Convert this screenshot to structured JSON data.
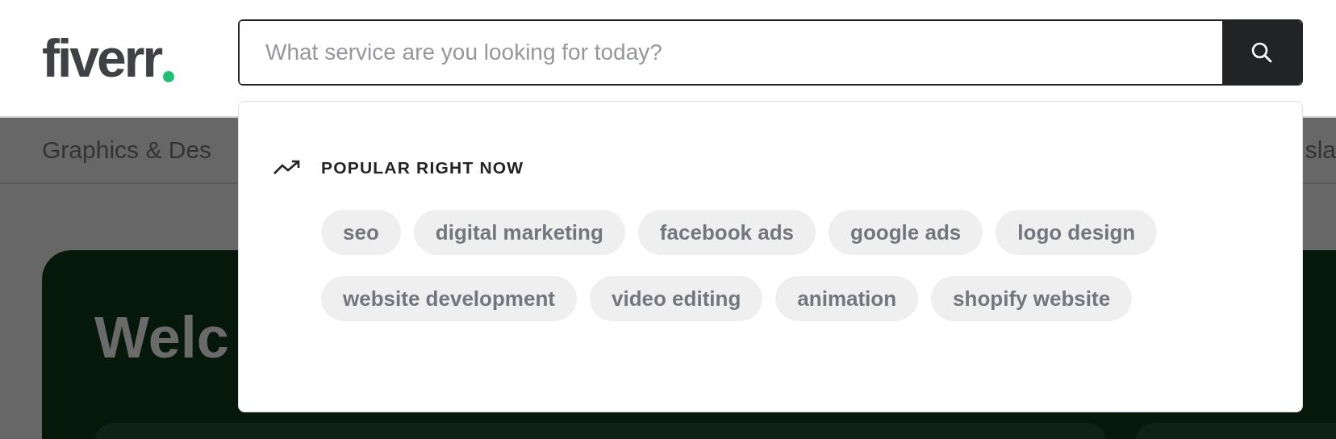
{
  "logo": {
    "text": "fiverr"
  },
  "search": {
    "placeholder": "What service are you looking for today?"
  },
  "nav": {
    "items": [
      "Graphics & Des",
      "sla"
    ]
  },
  "dropdown": {
    "heading": "POPULAR RIGHT NOW",
    "chips": [
      "seo",
      "digital marketing",
      "facebook ads",
      "google ads",
      "logo design",
      "website development",
      "video editing",
      "animation",
      "shopify website"
    ]
  },
  "hero": {
    "title": "Welc"
  }
}
